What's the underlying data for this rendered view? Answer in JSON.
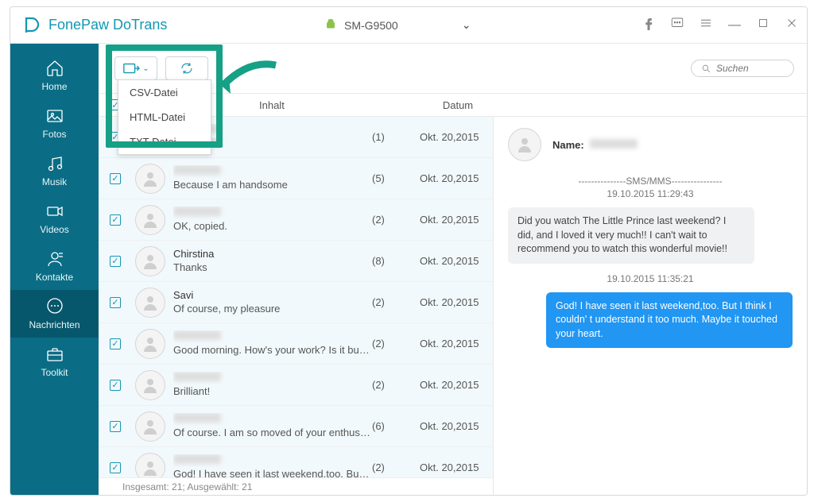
{
  "app": {
    "brand": "FonePaw DoTrans"
  },
  "device": {
    "name": "SM-G9500"
  },
  "sidebar": {
    "items": [
      {
        "label": "Home"
      },
      {
        "label": "Fotos"
      },
      {
        "label": "Musik"
      },
      {
        "label": "Videos"
      },
      {
        "label": "Kontakte"
      },
      {
        "label": "Nachrichten"
      },
      {
        "label": "Toolkit"
      }
    ]
  },
  "search": {
    "placeholder": "Suchen"
  },
  "columns": {
    "inhalt": "Inhalt",
    "datum": "Datum"
  },
  "export_menu": {
    "items": [
      "CSV-Datei",
      "HTML-Datei",
      "TXT-Datei"
    ]
  },
  "rows": [
    {
      "name": "",
      "snippet": "",
      "count": "(1)",
      "date": "Okt. 20,2015",
      "name_blur": true,
      "snippet_blur": true
    },
    {
      "name": "",
      "snippet": "Because I am handsome",
      "count": "(5)",
      "date": "Okt. 20,2015",
      "name_blur": true
    },
    {
      "name": "",
      "snippet": "OK, copied.",
      "count": "(2)",
      "date": "Okt. 20,2015",
      "name_blur": true
    },
    {
      "name": "Chirstina",
      "snippet": "Thanks",
      "count": "(8)",
      "date": "Okt. 20,2015"
    },
    {
      "name": "Savi",
      "snippet": "Of course, my pleasure",
      "count": "(2)",
      "date": "Okt. 20,2015"
    },
    {
      "name": "",
      "snippet": "Good morning. How's your work? Is it busy?",
      "count": "(2)",
      "date": "Okt. 20,2015",
      "name_blur": true
    },
    {
      "name": "",
      "snippet": "Brilliant!",
      "count": "(2)",
      "date": "Okt. 20,2015",
      "name_blur": true
    },
    {
      "name": "",
      "snippet": "Of course. I am so moved of your enthusiasm",
      "count": "(6)",
      "date": "Okt. 20,2015",
      "name_blur": true
    },
    {
      "name": "",
      "snippet": "God! I have seen it last weekend,too. But I think I ...",
      "count": "(2)",
      "date": "Okt. 20,2015",
      "name_blur": true
    }
  ],
  "status": "Insgesamt: 21; Ausgewählt: 21",
  "detail": {
    "name_label": "Name:",
    "divider": "---------------SMS/MMS----------------",
    "ts1": "19.10.2015 11:29:43",
    "msg_in": "Did you watch The Little Prince last weekend? I did, and I loved it very much!! I can't wait to recommend you to watch this wonderful movie!!",
    "ts2": "19.10.2015 11:35:21",
    "msg_out": "God! I have seen it last weekend,too. But I think I couldn' t understand it too much. Maybe it touched your heart."
  }
}
